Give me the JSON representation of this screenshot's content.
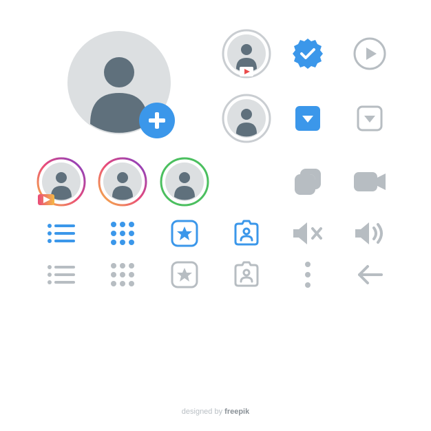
{
  "colors": {
    "avatar_bg": "#dcdfe1",
    "avatar_fill": "#5f707c",
    "blue": "#3b97ea",
    "gray": "#b7bdc2",
    "white": "#ffffff"
  },
  "footer": {
    "prefix": "designed by ",
    "brand": "freepik"
  },
  "icons": [
    "avatar-large-add",
    "avatar-video",
    "verified-badge",
    "play-circle",
    "avatar-plain",
    "dropdown-blue",
    "dropdown-gray",
    "avatar-story-gradient-video",
    "avatar-story-gradient",
    "avatar-story-green",
    "carousel",
    "camera",
    "list-view-blue",
    "grid-view-blue",
    "star-blue",
    "contact-blue",
    "mute",
    "speaker",
    "list-view-gray",
    "grid-view-gray",
    "star-gray",
    "contact-gray",
    "more-vertical",
    "back-arrow"
  ]
}
